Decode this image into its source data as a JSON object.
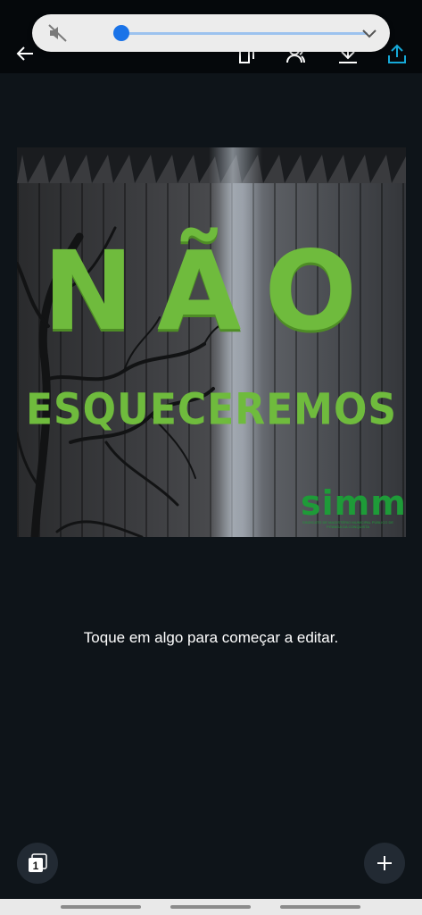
{
  "toolbar": {
    "back_icon": "arrow-left-icon",
    "icons": [
      "copy-pages-icon",
      "share-people-icon",
      "download-icon",
      "upload-icon"
    ],
    "accent": "#16a9d8"
  },
  "volume_popup": {
    "mute_icon": "volume-mute-icon",
    "level": 0,
    "expand_icon": "chevron-down-icon",
    "track_color": "#9cc2ee",
    "thumb_color": "#1a73e8"
  },
  "design": {
    "title": "NÃO",
    "subtitle": "ESQUECEREMOS",
    "logo_text": "simmp",
    "logo_small": "SINDICATO DE MAGISTÉRIO MUNICIPAL PÚBLICO DE PITANGA DA CONQUISTA",
    "text_color": "#6fbb3d",
    "logo_color": "#1e9b38"
  },
  "hint": "Toque em algo para começar a editar.",
  "pages_button": {
    "count": "1"
  },
  "add_button": {
    "icon": "plus-icon"
  }
}
